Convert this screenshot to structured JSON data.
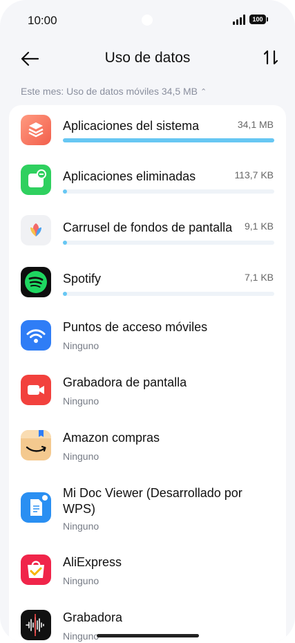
{
  "status": {
    "time": "10:00",
    "battery": "100"
  },
  "header": {
    "title": "Uso de datos"
  },
  "summary": {
    "text": "Este mes: Uso de datos móviles 34,5 MB"
  },
  "apps": [
    {
      "name": "Aplicaciones del sistema",
      "size": "34,1 MB",
      "usage_fraction": 1.0
    },
    {
      "name": "Aplicaciones eliminadas",
      "size": "113,7 KB",
      "usage_fraction": 0.01
    },
    {
      "name": "Carrusel de fondos de pantalla",
      "size": "9,1 KB",
      "usage_fraction": 0.01
    },
    {
      "name": "Spotify",
      "size": "7,1 KB",
      "usage_fraction": 0.01
    },
    {
      "name": "Puntos de acceso móviles",
      "status": "Ninguno"
    },
    {
      "name": "Grabadora de pantalla",
      "status": "Ninguno"
    },
    {
      "name": "Amazon compras",
      "status": "Ninguno"
    },
    {
      "name": "Mi Doc Viewer (Desarrollado por WPS)",
      "status": "Ninguno"
    },
    {
      "name": "AliExpress",
      "status": "Ninguno"
    },
    {
      "name": "Grabadora",
      "status": "Ninguno"
    }
  ],
  "icons": [
    "system-apps-icon",
    "deleted-apps-icon",
    "wallpaper-carousel-icon",
    "spotify-icon",
    "hotspot-icon",
    "screen-recorder-icon",
    "amazon-icon",
    "doc-viewer-icon",
    "aliexpress-icon",
    "recorder-icon"
  ],
  "colors": {
    "accent": "#67c7f3",
    "background": "#f5f6f9"
  }
}
